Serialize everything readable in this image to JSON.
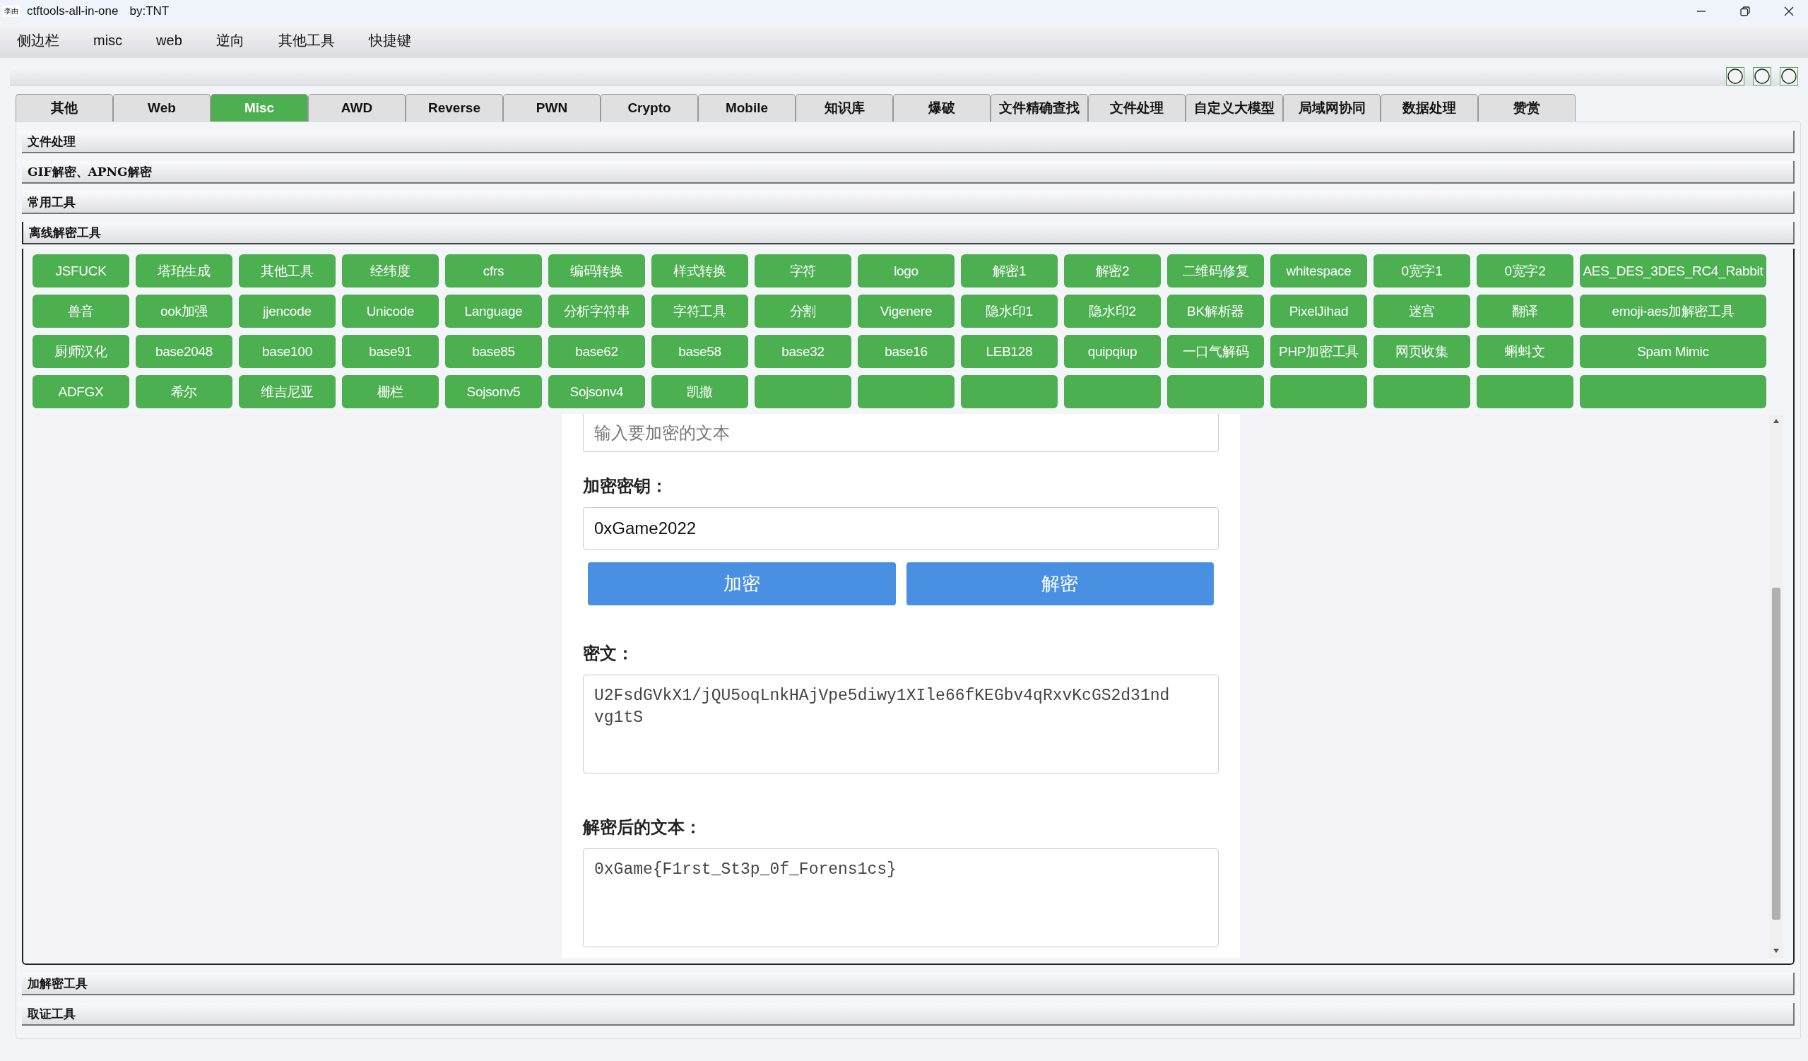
{
  "window": {
    "icon_text": "李由",
    "title": "ctftools-all-in-one",
    "subtitle": "by:TNT"
  },
  "menu": [
    "侧边栏",
    "misc",
    "web",
    "逆向",
    "其他工具",
    "快捷键"
  ],
  "tabs": [
    {
      "label": "其他",
      "selected": false
    },
    {
      "label": "Web",
      "selected": false
    },
    {
      "label": "Misc",
      "selected": true
    },
    {
      "label": "AWD",
      "selected": false
    },
    {
      "label": "Reverse",
      "selected": false
    },
    {
      "label": "PWN",
      "selected": false
    },
    {
      "label": "Crypto",
      "selected": false
    },
    {
      "label": "Mobile",
      "selected": false
    },
    {
      "label": "知识库",
      "selected": false
    },
    {
      "label": "爆破",
      "selected": false
    },
    {
      "label": "文件精确查找",
      "selected": false
    },
    {
      "label": "文件处理",
      "selected": false
    },
    {
      "label": "自定义大模型",
      "selected": false
    },
    {
      "label": "局域网协同",
      "selected": false
    },
    {
      "label": "数据处理",
      "selected": false
    },
    {
      "label": "赞赏",
      "selected": false
    }
  ],
  "sections": [
    {
      "label": "文件处理",
      "expanded": false
    },
    {
      "label": "GIF解密、APNG解密",
      "expanded": false
    },
    {
      "label": "常用工具",
      "expanded": false
    },
    {
      "label": "离线解密工具",
      "expanded": true
    },
    {
      "label": "加解密工具",
      "expanded": false
    },
    {
      "label": "取证工具",
      "expanded": false
    }
  ],
  "tool_buttons": [
    [
      {
        "kind": "labeled",
        "label": "JSFUCK"
      },
      {
        "kind": "labeled",
        "label": "塔珀生成"
      },
      {
        "kind": "labeled",
        "label": "其他工具"
      },
      {
        "kind": "labeled",
        "label": "经纬度"
      },
      {
        "kind": "labeled",
        "label": "cfrs"
      },
      {
        "kind": "labeled",
        "label": "编码转换"
      },
      {
        "kind": "labeled",
        "label": "样式转换"
      },
      {
        "kind": "labeled",
        "label": "字符"
      },
      {
        "kind": "labeled",
        "label": "logo"
      },
      {
        "kind": "labeled",
        "label": "解密1"
      },
      {
        "kind": "labeled",
        "label": "解密2"
      },
      {
        "kind": "labeled",
        "label": "二维码修复"
      },
      {
        "kind": "labeled",
        "label": "whitespace"
      },
      {
        "kind": "labeled",
        "label": "0宽字1"
      },
      {
        "kind": "labeled",
        "label": "0宽字2"
      },
      {
        "kind": "labeled",
        "label": "AES_DES_3DES_RC4_Rabbit"
      }
    ],
    [
      {
        "kind": "labeled",
        "label": "兽音"
      },
      {
        "kind": "labeled",
        "label": "ook加强"
      },
      {
        "kind": "labeled",
        "label": "jjencode"
      },
      {
        "kind": "labeled",
        "label": "Unicode"
      },
      {
        "kind": "labeled",
        "label": "Language"
      },
      {
        "kind": "labeled",
        "label": "分析字符串"
      },
      {
        "kind": "labeled",
        "label": "字符工具"
      },
      {
        "kind": "labeled",
        "label": "分割"
      },
      {
        "kind": "labeled",
        "label": "Vigenere"
      },
      {
        "kind": "labeled",
        "label": "隐水印1"
      },
      {
        "kind": "labeled",
        "label": "隐水印2"
      },
      {
        "kind": "labeled",
        "label": "BK解析器"
      },
      {
        "kind": "labeled",
        "label": "PixelJihad"
      },
      {
        "kind": "labeled",
        "label": "迷宫"
      },
      {
        "kind": "labeled",
        "label": "翻译"
      },
      {
        "kind": "labeled",
        "label": "emoji-aes加解密工具"
      }
    ],
    [
      {
        "kind": "labeled",
        "label": "厨师汉化"
      },
      {
        "kind": "labeled",
        "label": "base2048"
      },
      {
        "kind": "labeled",
        "label": "base100"
      },
      {
        "kind": "labeled",
        "label": "base91"
      },
      {
        "kind": "labeled",
        "label": "base85"
      },
      {
        "kind": "labeled",
        "label": "base62"
      },
      {
        "kind": "labeled",
        "label": "base58"
      },
      {
        "kind": "labeled",
        "label": "base32"
      },
      {
        "kind": "labeled",
        "label": "base16"
      },
      {
        "kind": "labeled",
        "label": "LEB128"
      },
      {
        "kind": "labeled",
        "label": "quipqiup"
      },
      {
        "kind": "labeled",
        "label": "一口气解码"
      },
      {
        "kind": "labeled",
        "label": "PHP加密工具"
      },
      {
        "kind": "labeled",
        "label": "网页收集"
      },
      {
        "kind": "labeled",
        "label": "蝌蚪文"
      },
      {
        "kind": "labeled",
        "label": "Spam Mimic"
      }
    ],
    [
      {
        "kind": "labeled",
        "label": "ADFGX"
      },
      {
        "kind": "labeled",
        "label": "希尔"
      },
      {
        "kind": "labeled",
        "label": "维吉尼亚"
      },
      {
        "kind": "labeled",
        "label": "栅栏"
      },
      {
        "kind": "labeled",
        "label": "Sojsonv5"
      },
      {
        "kind": "labeled",
        "label": "Sojsonv4"
      },
      {
        "kind": "labeled",
        "label": "凯撒"
      },
      {
        "kind": "blank"
      },
      {
        "kind": "blank"
      },
      {
        "kind": "blank"
      },
      {
        "kind": "blank"
      },
      {
        "kind": "blank"
      },
      {
        "kind": "blank"
      },
      {
        "kind": "blank"
      },
      {
        "kind": "blank"
      },
      {
        "kind": "blank"
      }
    ]
  ],
  "form": {
    "text_field": {
      "placeholder": "输入要加密的文本"
    },
    "key_label": "加密密钥：",
    "key_field": {
      "value": "0xGame2022"
    },
    "buttons": [
      "加密",
      "解密"
    ],
    "cipher_label": "密文：",
    "cipher_text": "U2FsdGVkX1/jQU5oqLnkHAjVpe5diwy1XIle66fKEGbv4qRxvKcGS2d31ndvg1tS",
    "plain_label": "解密后的文本：",
    "plain_text": "0xGame{F1rst_St3p_0f_Forens1cs}"
  }
}
